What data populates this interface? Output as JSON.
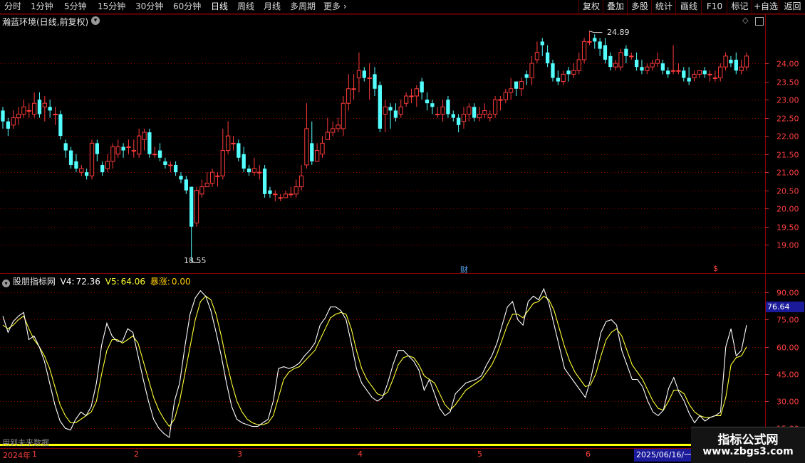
{
  "toolbar": {
    "periods": [
      "分时",
      "1分钟",
      "5分钟",
      "15分钟",
      "30分钟",
      "60分钟",
      "日线",
      "周线",
      "月线",
      "多周期",
      "更多"
    ],
    "active_period": "日线",
    "right": [
      "复权",
      "叠加",
      "多股",
      "统计",
      "画线",
      "F10",
      "标记",
      "+自选",
      "返回"
    ]
  },
  "stock": {
    "title": "瀚蓝环境(日线,前复权)",
    "high_label": "24.89",
    "low_label": "18.55",
    "markers": [
      "财",
      "$"
    ],
    "price_axis": [
      "24.00",
      "23.50",
      "23.00",
      "22.50",
      "22.00",
      "21.50",
      "21.00",
      "20.50",
      "20.00",
      "19.50",
      "19.00"
    ]
  },
  "indicator": {
    "name": "股朋指标网",
    "v4_label": "V4:",
    "v4_value": "72.36",
    "v5_label": "V5:",
    "v5_value": "64.06",
    "zhang_label": "暴涨:",
    "zhang_value": "0.00",
    "current_tag": "76.64",
    "axis": [
      "90.00",
      "75.00",
      "60.00",
      "45.00",
      "30.00",
      "15.00"
    ],
    "note": "用到未来数据"
  },
  "date_axis": {
    "year": "2024年",
    "months": [
      "1",
      "2",
      "3",
      "4",
      "5",
      "6"
    ],
    "cursor_date": "2025/06/16/一"
  },
  "watermark": {
    "title": "指标公式网",
    "url": "www.zbgs3.com"
  },
  "colors": {
    "up": "#ff3b3b",
    "down": "#54ffff",
    "v4_line": "#ffffff",
    "v5_line": "#ffff33",
    "grid": "#8a0000"
  },
  "chart_data": {
    "type": "candlestick",
    "ylim": [
      18.3,
      25.0
    ],
    "candles": [
      [
        22.7,
        22.4,
        22.8,
        22.2
      ],
      [
        22.4,
        22.2,
        22.5,
        22.0
      ],
      [
        22.3,
        22.5,
        22.7,
        22.2
      ],
      [
        22.5,
        22.6,
        22.8,
        22.3
      ],
      [
        22.6,
        22.8,
        23.0,
        22.5
      ],
      [
        22.7,
        22.7,
        22.9,
        22.5
      ],
      [
        22.6,
        22.9,
        23.2,
        22.5
      ],
      [
        23.0,
        22.6,
        23.2,
        22.5
      ],
      [
        22.8,
        22.9,
        23.1,
        22.4
      ],
      [
        22.8,
        22.7,
        23.0,
        22.5
      ],
      [
        22.6,
        22.6,
        22.8,
        22.3
      ],
      [
        22.6,
        22.0,
        22.7,
        21.9
      ],
      [
        21.8,
        21.6,
        21.9,
        21.4
      ],
      [
        21.6,
        21.2,
        21.7,
        21.1
      ],
      [
        21.3,
        21.1,
        21.5,
        21.0
      ],
      [
        21.0,
        21.1,
        21.2,
        20.9
      ],
      [
        21.0,
        20.9,
        21.1,
        20.8
      ],
      [
        20.9,
        21.8,
        21.9,
        20.8
      ],
      [
        21.8,
        21.5,
        21.9,
        21.3
      ],
      [
        21.2,
        21.0,
        21.3,
        20.9
      ],
      [
        21.1,
        21.3,
        21.5,
        21.0
      ],
      [
        21.3,
        21.7,
        21.8,
        21.1
      ],
      [
        21.5,
        21.7,
        21.9,
        21.4
      ],
      [
        21.7,
        21.6,
        21.8,
        21.4
      ],
      [
        21.7,
        21.7,
        21.9,
        21.5
      ],
      [
        21.6,
        21.6,
        21.9,
        21.4
      ],
      [
        21.5,
        22.0,
        22.2,
        21.4
      ],
      [
        21.9,
        22.1,
        22.2,
        21.6
      ],
      [
        22.1,
        21.5,
        22.2,
        21.4
      ],
      [
        21.5,
        21.5,
        21.7,
        21.4
      ],
      [
        21.6,
        21.4,
        21.8,
        21.3
      ],
      [
        21.3,
        21.2,
        21.4,
        21.1
      ],
      [
        21.2,
        21.2,
        21.3,
        21.0
      ],
      [
        21.2,
        21.0,
        21.3,
        20.9
      ],
      [
        20.9,
        20.8,
        21.0,
        20.7
      ],
      [
        20.8,
        20.5,
        20.9,
        20.4
      ],
      [
        20.6,
        19.5,
        20.6,
        18.55
      ],
      [
        19.6,
        20.5,
        20.6,
        19.5
      ],
      [
        20.4,
        20.6,
        20.8,
        20.3
      ],
      [
        20.6,
        20.7,
        21.0,
        20.6
      ],
      [
        20.7,
        21.0,
        21.1,
        20.6
      ],
      [
        20.9,
        20.9,
        21.0,
        20.6
      ],
      [
        20.9,
        21.6,
        22.2,
        20.8
      ],
      [
        21.6,
        22.0,
        22.4,
        21.5
      ],
      [
        21.8,
        21.8,
        22.0,
        21.6
      ],
      [
        21.8,
        21.4,
        21.9,
        21.3
      ],
      [
        21.5,
        21.1,
        21.7,
        21.0
      ],
      [
        21.1,
        21.0,
        21.2,
        20.9
      ],
      [
        21.0,
        21.1,
        21.4,
        20.9
      ],
      [
        21.0,
        21.0,
        21.2,
        20.8
      ],
      [
        21.1,
        20.4,
        21.2,
        20.3
      ],
      [
        20.5,
        20.4,
        20.6,
        20.3
      ],
      [
        20.4,
        20.4,
        20.5,
        20.2
      ],
      [
        20.3,
        20.3,
        20.4,
        20.2
      ],
      [
        20.3,
        20.4,
        20.5,
        20.3
      ],
      [
        20.4,
        20.4,
        20.6,
        20.3
      ],
      [
        20.4,
        20.6,
        20.8,
        20.3
      ],
      [
        20.6,
        20.9,
        21.2,
        20.5
      ],
      [
        21.2,
        22.2,
        22.9,
        21.1
      ],
      [
        21.8,
        21.3,
        22.4,
        21.2
      ],
      [
        21.3,
        21.6,
        21.8,
        21.3
      ],
      [
        21.5,
        21.8,
        22.0,
        21.4
      ],
      [
        21.9,
        22.1,
        22.5,
        21.9
      ],
      [
        22.1,
        22.2,
        22.4,
        22.0
      ],
      [
        22.2,
        22.3,
        22.5,
        22.1
      ],
      [
        22.2,
        22.9,
        23.1,
        22.0
      ],
      [
        22.9,
        23.3,
        23.7,
        22.7
      ],
      [
        23.3,
        23.3,
        23.7,
        23.0
      ],
      [
        23.6,
        23.8,
        24.3,
        23.2
      ],
      [
        23.8,
        23.6,
        23.9,
        23.5
      ],
      [
        23.6,
        23.6,
        24.0,
        23.0
      ],
      [
        23.7,
        23.3,
        23.9,
        23.1
      ],
      [
        23.4,
        22.2,
        23.5,
        22.1
      ],
      [
        22.6,
        22.8,
        23.0,
        22.1
      ],
      [
        22.8,
        22.7,
        22.9,
        22.2
      ],
      [
        22.7,
        22.5,
        22.9,
        22.4
      ],
      [
        22.6,
        22.8,
        23.0,
        22.5
      ],
      [
        22.9,
        23.1,
        23.2,
        22.8
      ],
      [
        23.1,
        23.1,
        23.3,
        22.9
      ],
      [
        23.1,
        23.3,
        23.4,
        22.8
      ],
      [
        23.5,
        23.2,
        23.6,
        23.0
      ],
      [
        23.0,
        22.9,
        23.2,
        22.7
      ],
      [
        22.9,
        22.8,
        23.0,
        22.6
      ],
      [
        22.6,
        22.6,
        22.8,
        22.5
      ],
      [
        22.6,
        22.8,
        23.0,
        22.4
      ],
      [
        23.0,
        22.6,
        23.1,
        22.5
      ],
      [
        22.6,
        22.5,
        22.7,
        22.4
      ],
      [
        22.5,
        22.3,
        22.6,
        22.1
      ],
      [
        22.4,
        22.6,
        22.8,
        22.2
      ],
      [
        22.6,
        22.8,
        22.9,
        22.4
      ],
      [
        22.8,
        22.5,
        22.9,
        22.4
      ],
      [
        22.5,
        22.6,
        22.8,
        22.4
      ],
      [
        22.6,
        22.7,
        22.9,
        22.5
      ],
      [
        22.5,
        22.6,
        22.7,
        22.4
      ],
      [
        22.6,
        23.0,
        23.1,
        22.5
      ],
      [
        23.0,
        23.0,
        23.1,
        22.7
      ],
      [
        23.0,
        23.2,
        23.3,
        22.9
      ],
      [
        23.2,
        23.3,
        23.6,
        23.0
      ],
      [
        23.5,
        23.3,
        23.5,
        23.1
      ],
      [
        23.3,
        23.5,
        23.6,
        23.1
      ],
      [
        23.7,
        23.6,
        23.8,
        23.4
      ],
      [
        23.6,
        24.0,
        24.2,
        23.4
      ],
      [
        24.1,
        24.3,
        24.6,
        24.0
      ],
      [
        24.6,
        24.5,
        24.7,
        24.2
      ],
      [
        24.3,
        24.0,
        24.5,
        23.9
      ],
      [
        24.0,
        23.6,
        24.1,
        23.5
      ],
      [
        23.6,
        23.5,
        23.8,
        23.4
      ],
      [
        23.5,
        23.7,
        23.8,
        23.4
      ],
      [
        23.8,
        23.7,
        23.9,
        23.5
      ],
      [
        23.7,
        23.8,
        24.0,
        23.6
      ],
      [
        23.8,
        24.1,
        24.3,
        23.7
      ],
      [
        24.1,
        24.6,
        24.7,
        24.0
      ],
      [
        24.6,
        24.6,
        24.89,
        24.5
      ],
      [
        24.7,
        24.6,
        24.8,
        24.4
      ],
      [
        24.6,
        24.4,
        24.7,
        24.2
      ],
      [
        24.5,
        24.1,
        24.7,
        24.0
      ],
      [
        24.2,
        23.9,
        24.3,
        23.8
      ],
      [
        23.9,
        24.0,
        24.1,
        23.8
      ],
      [
        23.9,
        24.3,
        24.4,
        23.8
      ],
      [
        24.4,
        24.2,
        24.5,
        24.0
      ],
      [
        24.2,
        24.2,
        24.3,
        24.1
      ],
      [
        24.1,
        23.9,
        24.3,
        23.8
      ],
      [
        23.9,
        23.8,
        24.1,
        23.7
      ],
      [
        23.8,
        23.9,
        24.0,
        23.7
      ],
      [
        23.9,
        24.0,
        24.1,
        23.8
      ],
      [
        24.0,
        24.1,
        24.3,
        23.9
      ],
      [
        24.0,
        23.8,
        24.1,
        23.7
      ],
      [
        23.8,
        23.7,
        23.9,
        23.6
      ],
      [
        23.8,
        23.8,
        24.5,
        23.7
      ],
      [
        23.8,
        23.8,
        24.0,
        23.7
      ],
      [
        23.8,
        23.6,
        23.9,
        23.5
      ],
      [
        23.6,
        23.5,
        23.9,
        23.4
      ],
      [
        23.6,
        23.7,
        23.8,
        23.5
      ],
      [
        23.7,
        23.8,
        23.8,
        23.6
      ],
      [
        23.8,
        23.7,
        23.9,
        23.6
      ],
      [
        23.7,
        23.7,
        23.8,
        23.5
      ],
      [
        23.6,
        23.6,
        23.8,
        23.5
      ],
      [
        23.6,
        23.9,
        24.0,
        23.5
      ],
      [
        23.9,
        24.2,
        24.3,
        23.8
      ],
      [
        24.1,
        24.0,
        24.2,
        23.9
      ],
      [
        24.1,
        23.8,
        24.3,
        23.7
      ],
      [
        23.8,
        23.9,
        24.1,
        23.7
      ],
      [
        23.9,
        24.2,
        24.3,
        23.8
      ]
    ],
    "indicator_ylim": [
      8,
      96
    ],
    "v4": [
      77,
      68,
      74,
      77,
      79,
      64,
      66,
      60,
      52,
      40,
      28,
      19,
      15,
      14,
      20,
      24,
      22,
      27,
      40,
      61,
      73,
      66,
      63,
      63,
      70,
      68,
      55,
      42,
      30,
      20,
      15,
      12,
      10,
      30,
      40,
      60,
      78,
      87,
      91,
      88,
      80,
      68,
      55,
      40,
      27,
      20,
      18,
      17,
      16,
      16,
      18,
      20,
      30,
      48,
      49,
      48,
      49,
      51,
      55,
      58,
      62,
      72,
      76,
      82,
      82,
      80,
      75,
      62,
      48,
      40,
      36,
      32,
      30,
      32,
      40,
      50,
      58,
      58,
      55,
      52,
      47,
      36,
      42,
      34,
      26,
      22,
      24,
      34,
      37,
      40,
      41,
      42,
      44,
      50,
      55,
      62,
      72,
      82,
      85,
      75,
      72,
      85,
      88,
      86,
      92,
      84,
      72,
      60,
      48,
      44,
      40,
      36,
      32,
      42,
      55,
      68,
      74,
      75,
      72,
      58,
      50,
      42,
      42,
      38,
      30,
      24,
      22,
      25,
      37,
      43,
      35,
      30,
      23,
      18,
      22,
      19,
      21,
      22,
      24,
      60,
      70,
      55,
      58,
      72
    ],
    "v5": [
      72,
      70,
      72,
      75,
      77,
      70,
      64,
      60,
      55,
      48,
      38,
      28,
      22,
      18,
      18,
      20,
      22,
      24,
      30,
      45,
      58,
      64,
      64,
      62,
      64,
      66,
      62,
      52,
      42,
      32,
      25,
      20,
      16,
      20,
      30,
      45,
      60,
      75,
      85,
      88,
      86,
      78,
      66,
      52,
      40,
      30,
      24,
      20,
      18,
      17,
      17,
      18,
      22,
      32,
      42,
      46,
      48,
      49,
      52,
      55,
      58,
      64,
      70,
      76,
      78,
      79,
      78,
      70,
      58,
      48,
      42,
      38,
      34,
      33,
      35,
      42,
      50,
      54,
      55,
      54,
      50,
      44,
      42,
      40,
      34,
      28,
      25,
      28,
      32,
      36,
      38,
      40,
      42,
      46,
      50,
      56,
      64,
      72,
      78,
      78,
      76,
      80,
      84,
      85,
      88,
      86,
      80,
      70,
      60,
      52,
      46,
      42,
      38,
      39,
      45,
      55,
      64,
      68,
      70,
      66,
      58,
      50,
      46,
      42,
      36,
      30,
      26,
      25,
      30,
      36,
      36,
      34,
      28,
      24,
      22,
      21,
      21,
      22,
      22,
      32,
      50,
      54,
      55,
      60
    ]
  }
}
